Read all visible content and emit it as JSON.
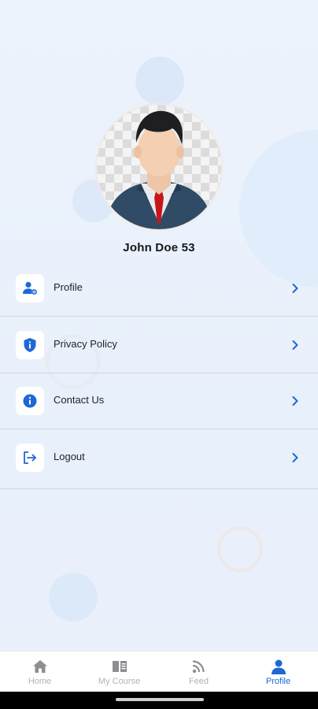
{
  "profile": {
    "username": "John Doe 53"
  },
  "menu": {
    "items": [
      {
        "label": "Profile",
        "icon": "user-settings-icon"
      },
      {
        "label": "Privacy Policy",
        "icon": "shield-icon"
      },
      {
        "label": "Contact Us",
        "icon": "info-icon"
      },
      {
        "label": "Logout",
        "icon": "logout-icon"
      }
    ]
  },
  "bottom_nav": {
    "items": [
      {
        "label": "Home",
        "icon": "home-icon",
        "active": false
      },
      {
        "label": "My Course",
        "icon": "book-icon",
        "active": false
      },
      {
        "label": "Feed",
        "icon": "rss-icon",
        "active": false
      },
      {
        "label": "Profile",
        "icon": "person-icon",
        "active": true
      }
    ]
  },
  "colors": {
    "accent": "#1f67d6",
    "background": "#eaf1fb",
    "inactive": "#b3b3b6"
  }
}
